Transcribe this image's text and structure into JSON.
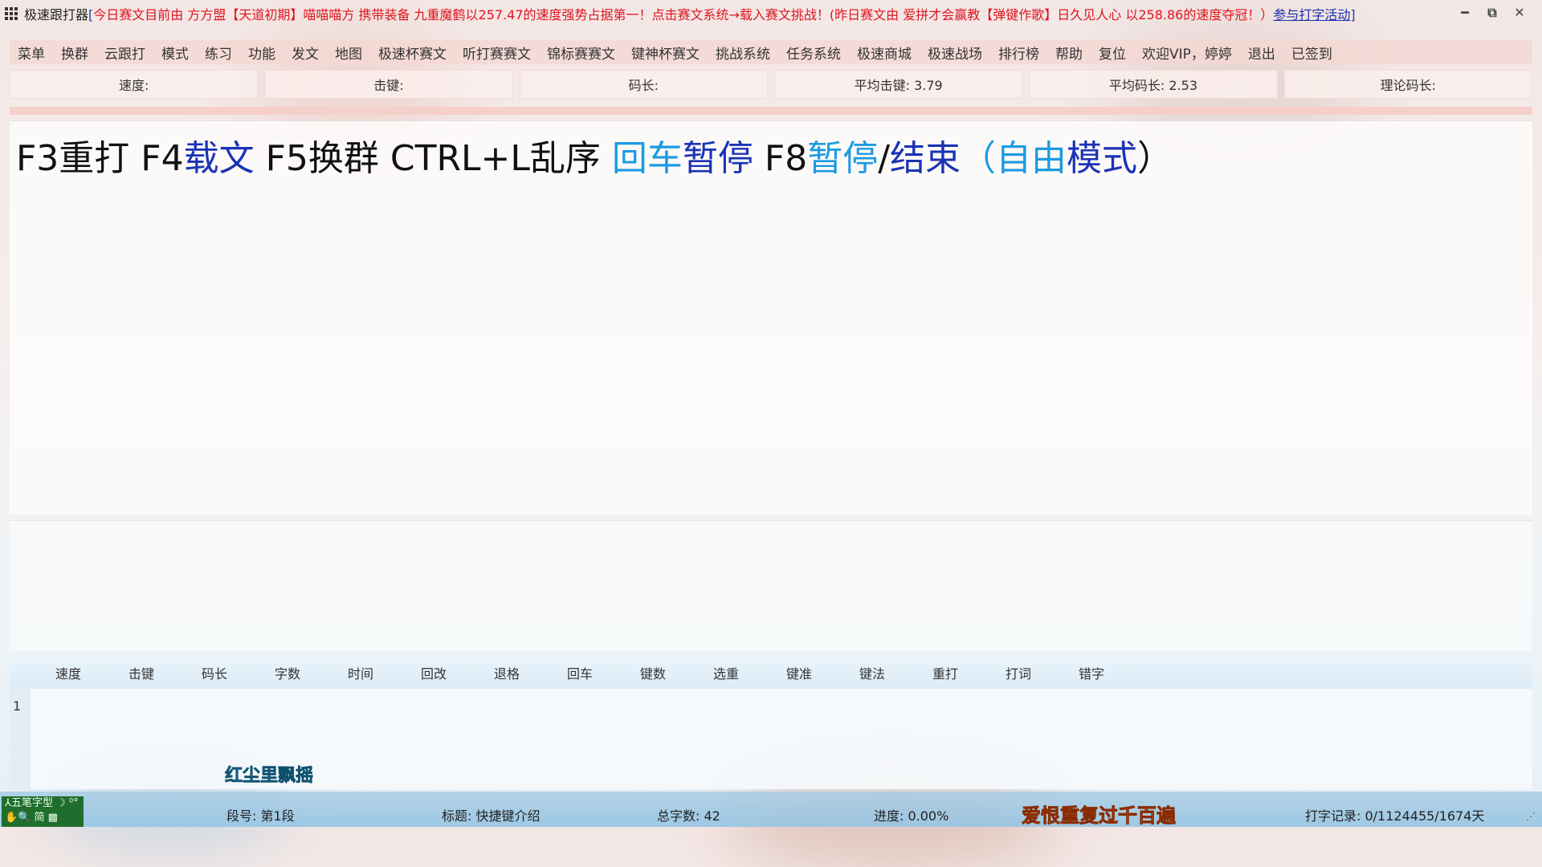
{
  "titlebar": {
    "app_name": "极速跟打器",
    "bracket_open": "[",
    "marquee": "今日赛文目前由 方方盟【天道初期】喵喵喵方 携带装备 九重魔鹤以257.47的速度强势占据第一！点击赛文系统→载入赛文挑战！(昨日赛文由 爱拼才会赢教【弹键作歌】日久见人心 以258.86的速度夺冠！）",
    "activity_link": "参与打字活动",
    "bracket_close": "]",
    "minimize": "━",
    "restore": "⧉",
    "close": "✕"
  },
  "menu": {
    "items": [
      "菜单",
      "换群",
      "云跟打",
      "模式",
      "练习",
      "功能",
      "发文",
      "地图",
      "极速杯赛文",
      "听打赛赛文",
      "锦标赛赛文",
      "键神杯赛文",
      "挑战系统",
      "任务系统",
      "极速商城",
      "极速战场",
      "排行榜",
      "帮助",
      "复位",
      "欢迎VIP，婷婷",
      "退出",
      "已签到"
    ]
  },
  "stats": {
    "speed": "速度:",
    "keystroke": "击键:",
    "code_len": "码长:",
    "avg_keystroke": "平均击键: 3.79",
    "avg_code_len": "平均码长: 2.53",
    "theory_code_len": "理论码长:"
  },
  "prompt": {
    "p1": "F3重打 F4",
    "p2": "载文",
    "p3": " F5换群 CTRL+L乱序 ",
    "p4": "回车",
    "p5": "暂停",
    "p6": " F8",
    "p7": "暂停",
    "p8": "/",
    "p9": "结束",
    "p10": "（",
    "p11": "自由",
    "p12": "模式",
    "p13": "）"
  },
  "results": {
    "columns": [
      "速度",
      "击键",
      "码长",
      "字数",
      "时间",
      "回改",
      "退格",
      "回车",
      "键数",
      "选重",
      "键准",
      "键法",
      "重打",
      "打词",
      "错字"
    ],
    "row_number": "1"
  },
  "decor": {
    "red_dust": "红尘里飘摇"
  },
  "ime": {
    "line1": "⅄五笔字型 ☽ ⁰°",
    "line2": "✋🔍 简 ▩"
  },
  "status": {
    "segment": "段号: 第1段",
    "title": "标题: 快捷键介绍",
    "total_chars": "总字数: 42",
    "progress": "进度: 0.00%",
    "slogan": "爱恨重复过千百遍",
    "record": "打字记录: 0/1124455/1674天"
  },
  "colors": {
    "marquee_red": "#e0141e",
    "navy": "#1a33b5",
    "sky": "#1b9be0"
  }
}
